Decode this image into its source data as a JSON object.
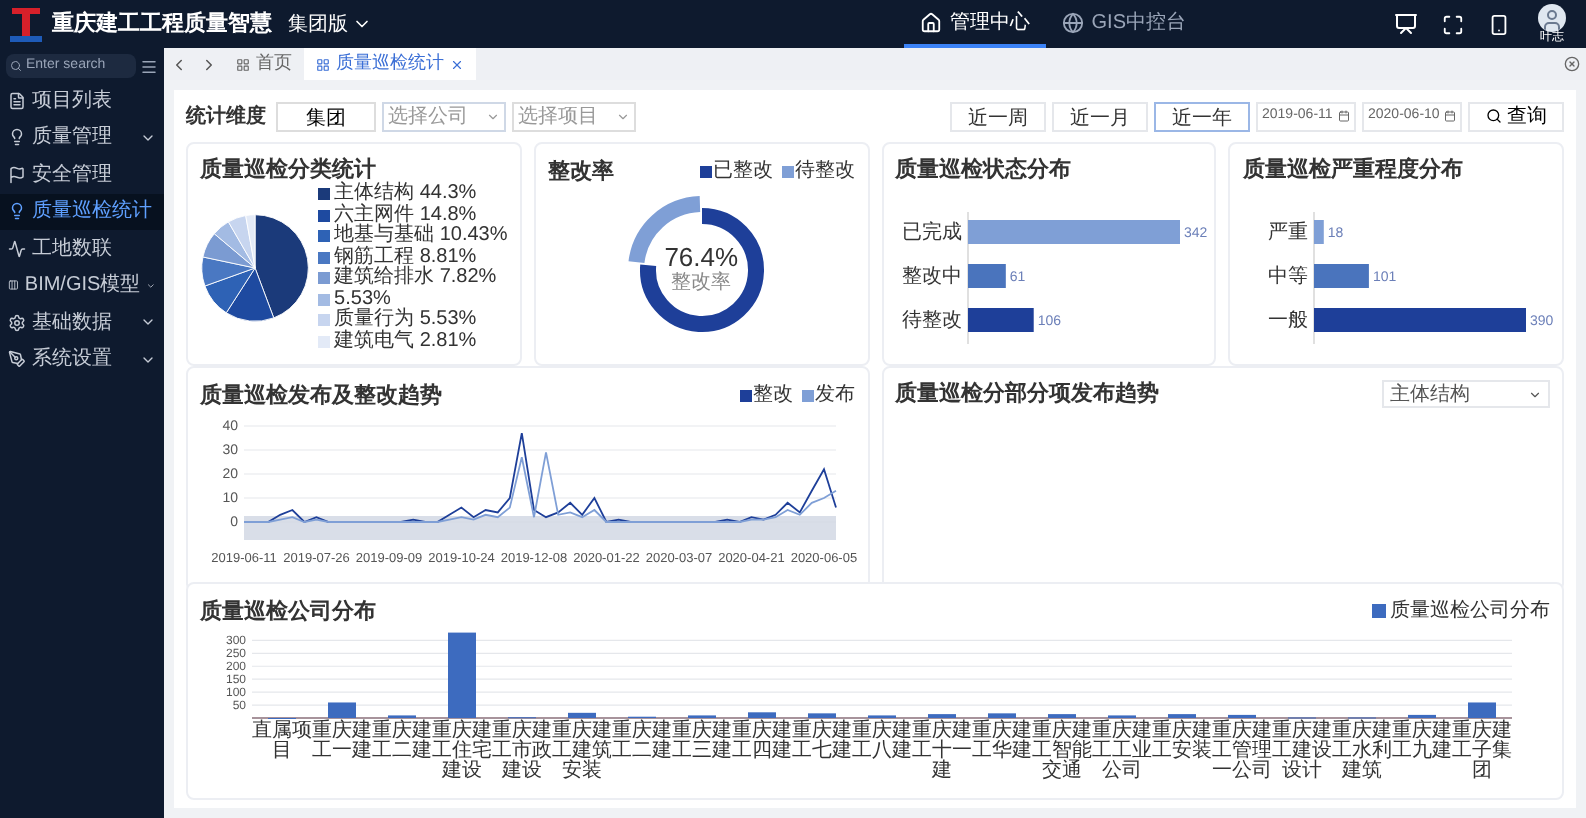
{
  "header": {
    "title": "重庆建工工程质量智慧",
    "version": "集团版",
    "nav": [
      {
        "label": "管理中心",
        "selected": true
      },
      {
        "label": "GIS中控台",
        "selected": false
      }
    ],
    "user": "叶志"
  },
  "sidebar": {
    "search": {
      "placeholder": "Enter search"
    },
    "items": [
      {
        "label": "项目列表",
        "selected": false
      },
      {
        "label": "质量管理",
        "selected": false,
        "expanded": false
      },
      {
        "label": "安全管理",
        "selected": false
      },
      {
        "label": "质量巡检统计",
        "selected": true
      },
      {
        "label": "工地数联",
        "selected": false
      },
      {
        "label": "BIM/GIS模型",
        "selected": false,
        "expanded": false
      },
      {
        "label": "基础数据",
        "selected": false,
        "expanded": false
      },
      {
        "label": "系统设置",
        "selected": false,
        "expanded": false
      }
    ]
  },
  "tabs": [
    {
      "label": "首页",
      "selected": false,
      "closable": false
    },
    {
      "label": "质量巡检统计",
      "selected": true,
      "closable": true
    }
  ],
  "filters": {
    "label": "统计维度",
    "scope": "集团",
    "company": {
      "placeholder": "选择公司"
    },
    "project": {
      "placeholder": "选择项目"
    },
    "ranges": [
      {
        "label": "近一周",
        "selected": false
      },
      {
        "label": "近一月",
        "selected": false
      },
      {
        "label": "近一年",
        "selected": true
      }
    ],
    "start_date": "2019-06-11",
    "end_date": "2020-06-10",
    "search": "查询"
  },
  "category_stats": {
    "title": "质量巡检分类统计",
    "items": [
      {
        "name": "主体结构",
        "percent": "44.3%",
        "color": "#1b3a7a"
      },
      {
        "name": "六主网件",
        "percent": "14.8%",
        "color": "#1e4aa0"
      },
      {
        "name": "地基与基础",
        "percent": "10.43%",
        "color": "#2e62b5"
      },
      {
        "name": "钢筋工程",
        "percent": "8.81%",
        "color": "#4a78c2"
      },
      {
        "name": "建筑给排水",
        "percent": "7.82%",
        "color": "#7b9bd2"
      },
      {
        "percent": "5.53%",
        "color": "#a3bbe3"
      },
      {
        "name": "质量行为",
        "percent": "5.53%",
        "color": "#c7d5ef"
      },
      {
        "name": "建筑电气",
        "percent": "2.81%",
        "color": "#e3eaf7"
      }
    ]
  },
  "rectify": {
    "title": "整改率",
    "legend": [
      {
        "label": "已整改",
        "color": "#1e3f99"
      },
      {
        "label": "待整改",
        "color": "#7f9fd6"
      }
    ],
    "reading": "76.4%",
    "caption": "整改率"
  },
  "status": {
    "title": "质量巡检状态分布",
    "chart_data": {
      "type": "bar",
      "orientation": "horizontal",
      "data_labels": true,
      "categories": [
        "已完成",
        "整改中",
        "待整改"
      ],
      "series": [
        {
          "values": [
            342,
            61,
            106
          ]
        }
      ]
    }
  },
  "severity": {
    "title": "质量巡检严重程度分布",
    "chart_data": {
      "type": "bar",
      "orientation": "horizontal",
      "data_labels": true,
      "categories": [
        "严重",
        "中等",
        "一般"
      ],
      "series": [
        {
          "values": [
            18,
            101,
            390
          ]
        }
      ]
    }
  },
  "trend": {
    "title": "质量巡检发布及整改趋势",
    "chart_data": {
      "type": "line",
      "grid": true,
      "ylim": [
        0,
        40
      ],
      "yticks": [
        0,
        10,
        20,
        30,
        40
      ],
      "categories": [
        "2019-06-11",
        null,
        null,
        null,
        null,
        null,
        "2019-07-26",
        null,
        null,
        null,
        null,
        null,
        "2019-09-09",
        null,
        null,
        null,
        null,
        null,
        "2019-10-24",
        null,
        null,
        null,
        null,
        null,
        "2019-12-08",
        null,
        null,
        null,
        null,
        null,
        "2020-01-22",
        null,
        null,
        null,
        null,
        null,
        "2020-03-07",
        null,
        null,
        null,
        null,
        null,
        "2020-04-21",
        null,
        null,
        null,
        null,
        null,
        "2020-06-05",
        null
      ],
      "series": [
        {
          "name": "整改",
          "color": "#1e3f99",
          "values": [
            0,
            0,
            0,
            3,
            5,
            0,
            2,
            0,
            0,
            0,
            0,
            0,
            0,
            0,
            1,
            0,
            0,
            3,
            6,
            2,
            5,
            4,
            10,
            37,
            5,
            2,
            4,
            8,
            3,
            10,
            0,
            1,
            0,
            0,
            0,
            0,
            0,
            0,
            0,
            0,
            1,
            0,
            2,
            1,
            3,
            8,
            4,
            13,
            22,
            6
          ]
        },
        {
          "name": "发布",
          "color": "#7f9fd6",
          "values": [
            0,
            0,
            0,
            1,
            2,
            0,
            1,
            0,
            0,
            0,
            0,
            0,
            0,
            0,
            0,
            0,
            0,
            1,
            2,
            1,
            3,
            2,
            6,
            27,
            2,
            29,
            3,
            4,
            2,
            5,
            0,
            0,
            0,
            0,
            0,
            0,
            0,
            0,
            0,
            0,
            0,
            0,
            1,
            1,
            2,
            5,
            3,
            8,
            10,
            13
          ]
        }
      ]
    }
  },
  "sub_trend": {
    "title": "质量巡检分部分项发布趋势",
    "select": "主体结构"
  },
  "company": {
    "title": "质量巡检公司分布",
    "chart_data": {
      "type": "bar",
      "grid": true,
      "ylim": [
        0,
        340
      ],
      "yticks": [
        50,
        100,
        150,
        200,
        250,
        300
      ],
      "categories": [
        "直属项目",
        "重庆建工一建",
        "重庆建工二建",
        "重庆建工住宅建设",
        "重庆建工市政建设",
        "重庆建工建筑安装",
        "重庆建工二建",
        "重庆建工三建",
        "重庆建工四建",
        "重庆建工七建",
        "重庆建工八建",
        "重庆建工十一建",
        "重庆建工华建",
        "重庆建工智能交通",
        "重庆建工工业公司",
        "重庆建工安装",
        "重庆建工管理一公司",
        "重庆建工建设设计",
        "重庆建工水利建筑",
        "重庆建工九建",
        "重庆建工子集团"
      ],
      "series": [
        {
          "name": "质量巡检公司分布",
          "color": "#3d6bbf",
          "values": [
            0,
            60,
            10,
            330,
            3,
            20,
            5,
            10,
            22,
            18,
            10,
            15,
            18,
            15,
            10,
            15,
            12,
            2,
            2,
            12,
            60
          ]
        }
      ]
    }
  }
}
